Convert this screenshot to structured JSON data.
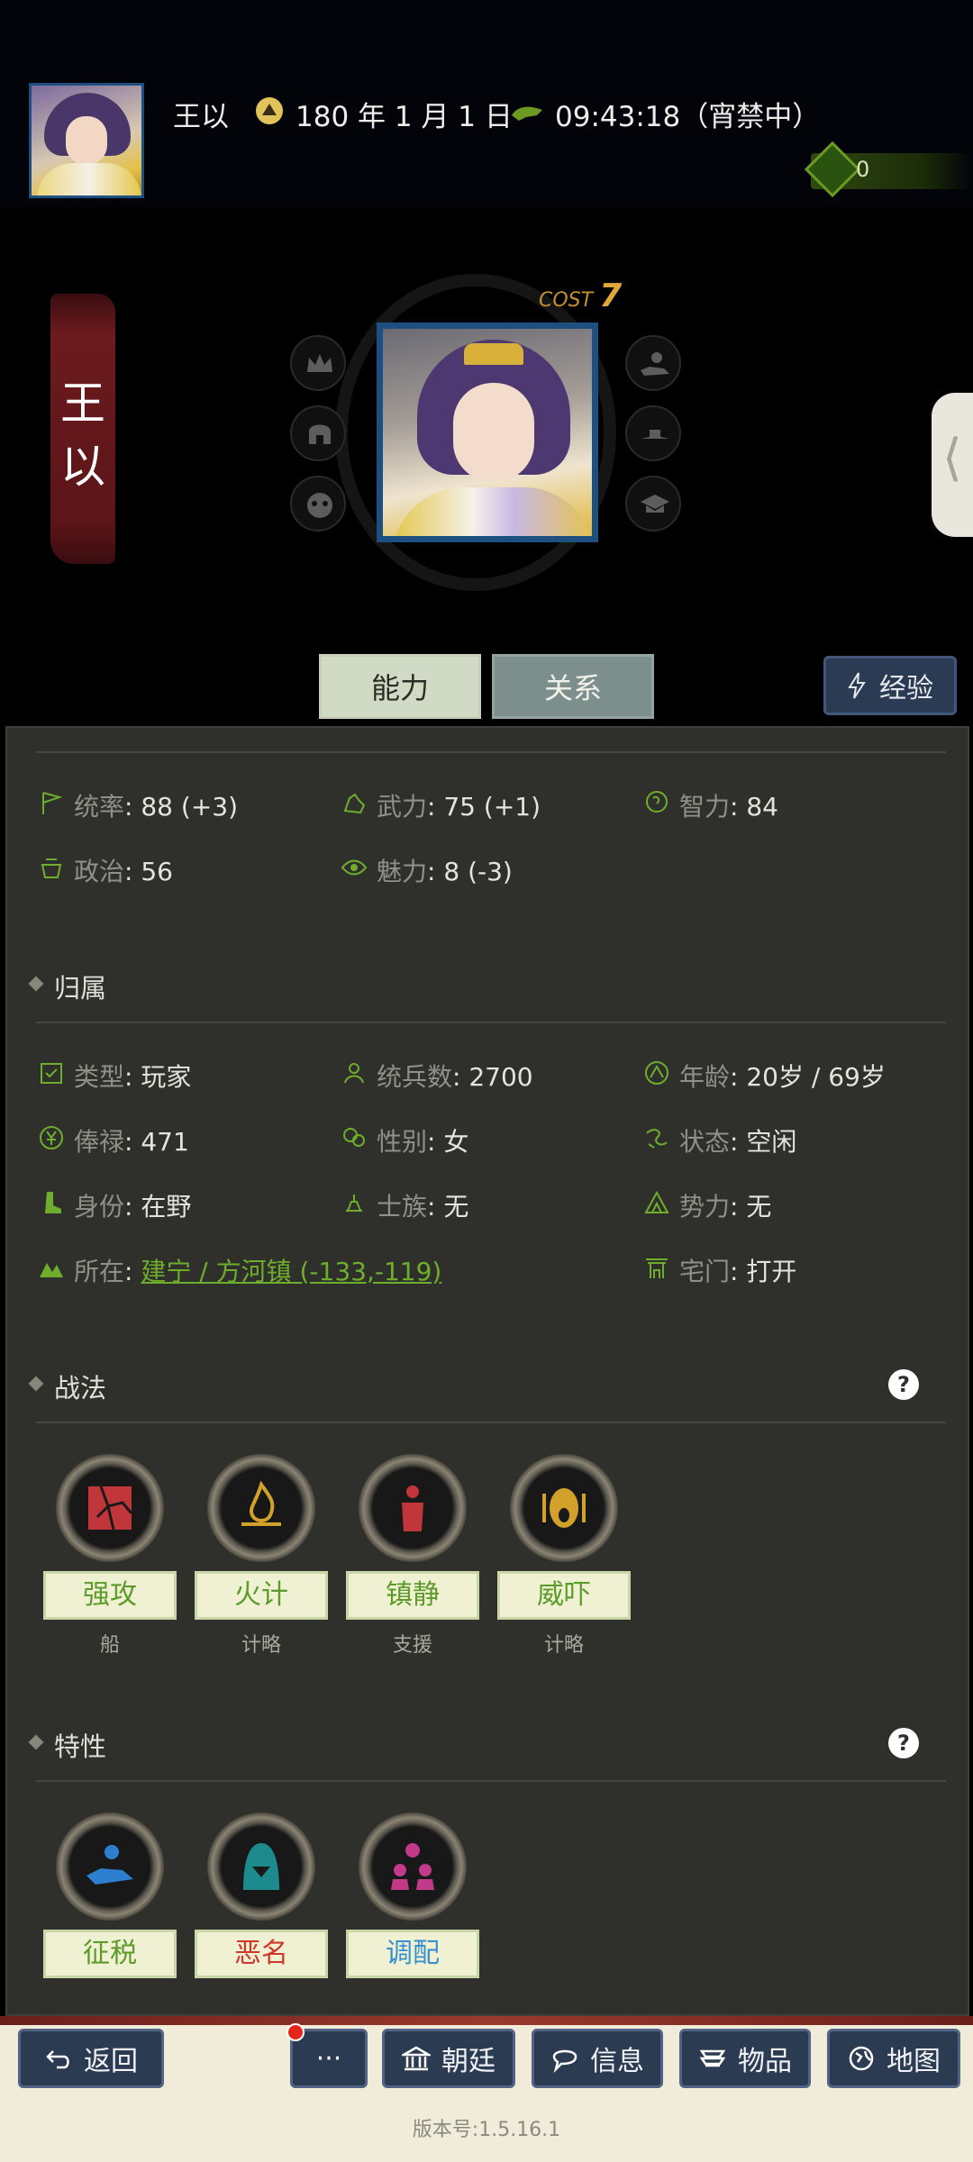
{
  "header": {
    "name": "王以",
    "date": "180 年 1 月 1 日",
    "time": "09:43:18（宵禁中）",
    "money": "0"
  },
  "portrait": {
    "name_char_1": "王",
    "name_char_2": "以",
    "cost_label": "COST",
    "cost_value": "7"
  },
  "tabs": {
    "ability": "能力",
    "relation": "关系",
    "experience": "经验"
  },
  "attributes": [
    {
      "key": "统率",
      "value": "88 (+3)"
    },
    {
      "key": "武力",
      "value": "75 (+1)"
    },
    {
      "key": "智力",
      "value": "84"
    },
    {
      "key": "政治",
      "value": "56"
    },
    {
      "key": "魅力",
      "value": "8 (-3)"
    }
  ],
  "belonging": {
    "title": "归属",
    "type_k": "类型",
    "type_v": "玩家",
    "troops_k": "统兵数",
    "troops_v": "2700",
    "age_k": "年龄",
    "age_v": "20岁 / 69岁",
    "salary_k": "俸禄",
    "salary_v": "471",
    "gender_k": "性别",
    "gender_v": "女",
    "state_k": "状态",
    "state_v": "空闲",
    "identity_k": "身份",
    "identity_v": "在野",
    "clan_k": "士族",
    "clan_v": "无",
    "faction_k": "势力",
    "faction_v": "无",
    "location_k": "所在",
    "location_v": "建宁 / 方河镇 (-133,-119)",
    "gate_k": "宅门",
    "gate_v": "打开"
  },
  "tactics": {
    "title": "战法",
    "items": [
      {
        "name": "强攻",
        "sub": "船"
      },
      {
        "name": "火计",
        "sub": "计略"
      },
      {
        "name": "镇静",
        "sub": "支援"
      },
      {
        "name": "威吓",
        "sub": "计略"
      }
    ]
  },
  "traits": {
    "title": "特性",
    "items": [
      {
        "name": "征税"
      },
      {
        "name": "恶名"
      },
      {
        "name": "调配"
      }
    ]
  },
  "nav": {
    "back": "返回",
    "more": "···",
    "court": "朝廷",
    "info": "信息",
    "items": "物品",
    "map": "地图"
  },
  "version": "版本号:1.5.16.1",
  "colors": {
    "accent_green": "#6fae2c",
    "trait_bad": "#d0362a",
    "trait_blue": "#3a8fd0",
    "nav_button": "#2b3b52"
  }
}
